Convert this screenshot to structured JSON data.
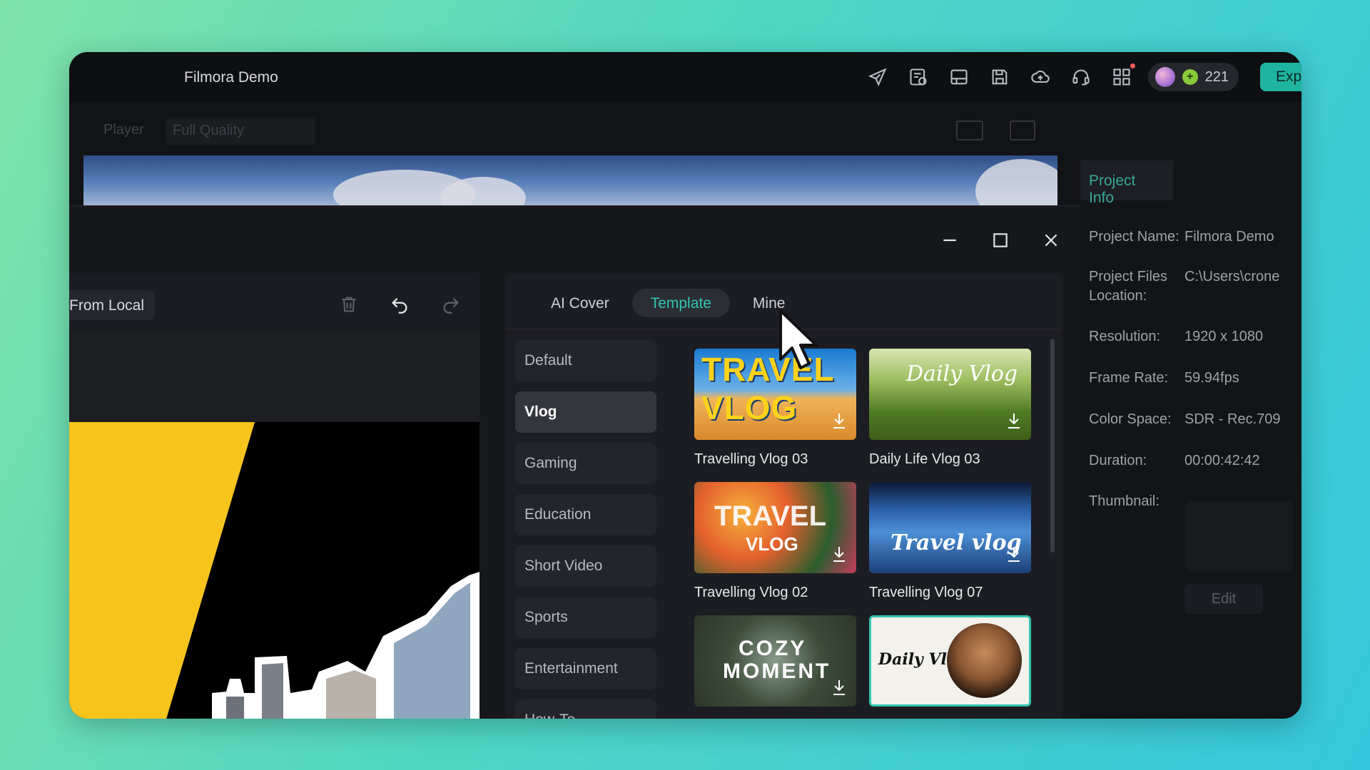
{
  "window": {
    "title": "Filmora Demo"
  },
  "toolbar": {
    "icons": [
      "send-icon",
      "task-list-icon",
      "layout-icon",
      "save-icon",
      "cloud-upload-icon",
      "headset-icon",
      "apps-grid-icon"
    ],
    "credits": "221",
    "export_label": "Export",
    "accent": "#1fb4a0"
  },
  "player": {
    "label": "Player",
    "quality": "Full Quality"
  },
  "project_info": {
    "tab": "Project Info",
    "fields": [
      {
        "label": "Project Name:",
        "value": "Filmora Demo"
      },
      {
        "label": "Project Files Location:",
        "value": "C:\\Users\\crone"
      },
      {
        "label": "Resolution:",
        "value": "1920 x 1080"
      },
      {
        "label": "Frame Rate:",
        "value": "59.94fps"
      },
      {
        "label": "Color Space:",
        "value": "SDR - Rec.709"
      },
      {
        "label": "Duration:",
        "value": "00:00:42:42"
      },
      {
        "label": "Thumbnail:",
        "value": ""
      }
    ],
    "edit_label": "Edit"
  },
  "dialog": {
    "from_local": "From Local",
    "tabs": [
      "AI Cover",
      "Template",
      "Mine"
    ],
    "active_tab": "Template",
    "categories": [
      "Default",
      "Vlog",
      "Gaming",
      "Education",
      "Short Video",
      "Sports",
      "Entertainment",
      "How-To"
    ],
    "active_category": "Vlog",
    "templates": [
      {
        "title": "Travelling Vlog 03",
        "art": "TRAVEL VLOG"
      },
      {
        "title": "Daily Life Vlog 03",
        "art": "Daily Vlog"
      },
      {
        "title": "Travelling Vlog 02",
        "art_big": "TRAVEL",
        "art_small": "VLOG"
      },
      {
        "title": "Travelling Vlog 07",
        "art": "Travel vlog"
      },
      {
        "title": "",
        "art_top": "COZY",
        "art_bottom": "MOMENT"
      },
      {
        "title": "",
        "art": "Daily Vlog"
      }
    ]
  }
}
